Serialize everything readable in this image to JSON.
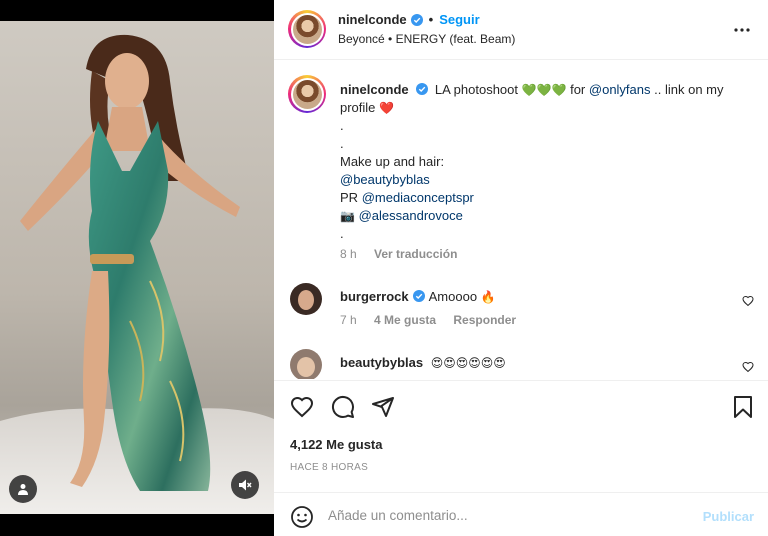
{
  "post": {
    "username": "ninelconde",
    "follow_label": "Seguir",
    "audio": "Beyoncé • ENERGY (feat. Beam)"
  },
  "caption": {
    "username": "ninelconde",
    "text_start": "LA photoshoot",
    "emojis_hearts": "💚💚💚",
    "text_for": "for",
    "mention_onlyfans": "@onlyfans",
    "text_link": ".. link on my profile",
    "emoji_red_heart": "❤️",
    "dot1": ".",
    "dot2": ".",
    "makeup_line": "Make up and hair:",
    "mention_beauty": "@beautybyblas",
    "pr_label": "PR",
    "mention_media": "@mediaconceptspr",
    "camera_emoji": "📷",
    "mention_alessandro": "@alessandrovoce",
    "dot3": ".",
    "time": "8 h",
    "translate": "Ver traducción"
  },
  "comments": [
    {
      "username": "burgerrock",
      "text": "Amoooo",
      "emoji": "🔥",
      "time": "7 h",
      "likes": "4 Me gusta",
      "reply": "Responder"
    },
    {
      "username": "beautybyblas",
      "emoji": "😍😍😍😍😍😍"
    }
  ],
  "engagement": {
    "likes": "4,122 Me gusta",
    "posted": "HACE 8 HORAS"
  },
  "add_comment": {
    "placeholder": "Añade un comentario...",
    "publish": "Publicar"
  },
  "colors": {
    "accent": "#0095f6",
    "verified": "#3897f0",
    "link": "#00376b",
    "muted": "#8e8e8e",
    "publish_disabled": "#b2dffc"
  },
  "icons": [
    "more-options-icon",
    "heart-icon",
    "comment-icon",
    "share-icon",
    "bookmark-icon",
    "emoji-icon",
    "user-tag-icon",
    "mute-icon",
    "verified-badge-icon"
  ]
}
